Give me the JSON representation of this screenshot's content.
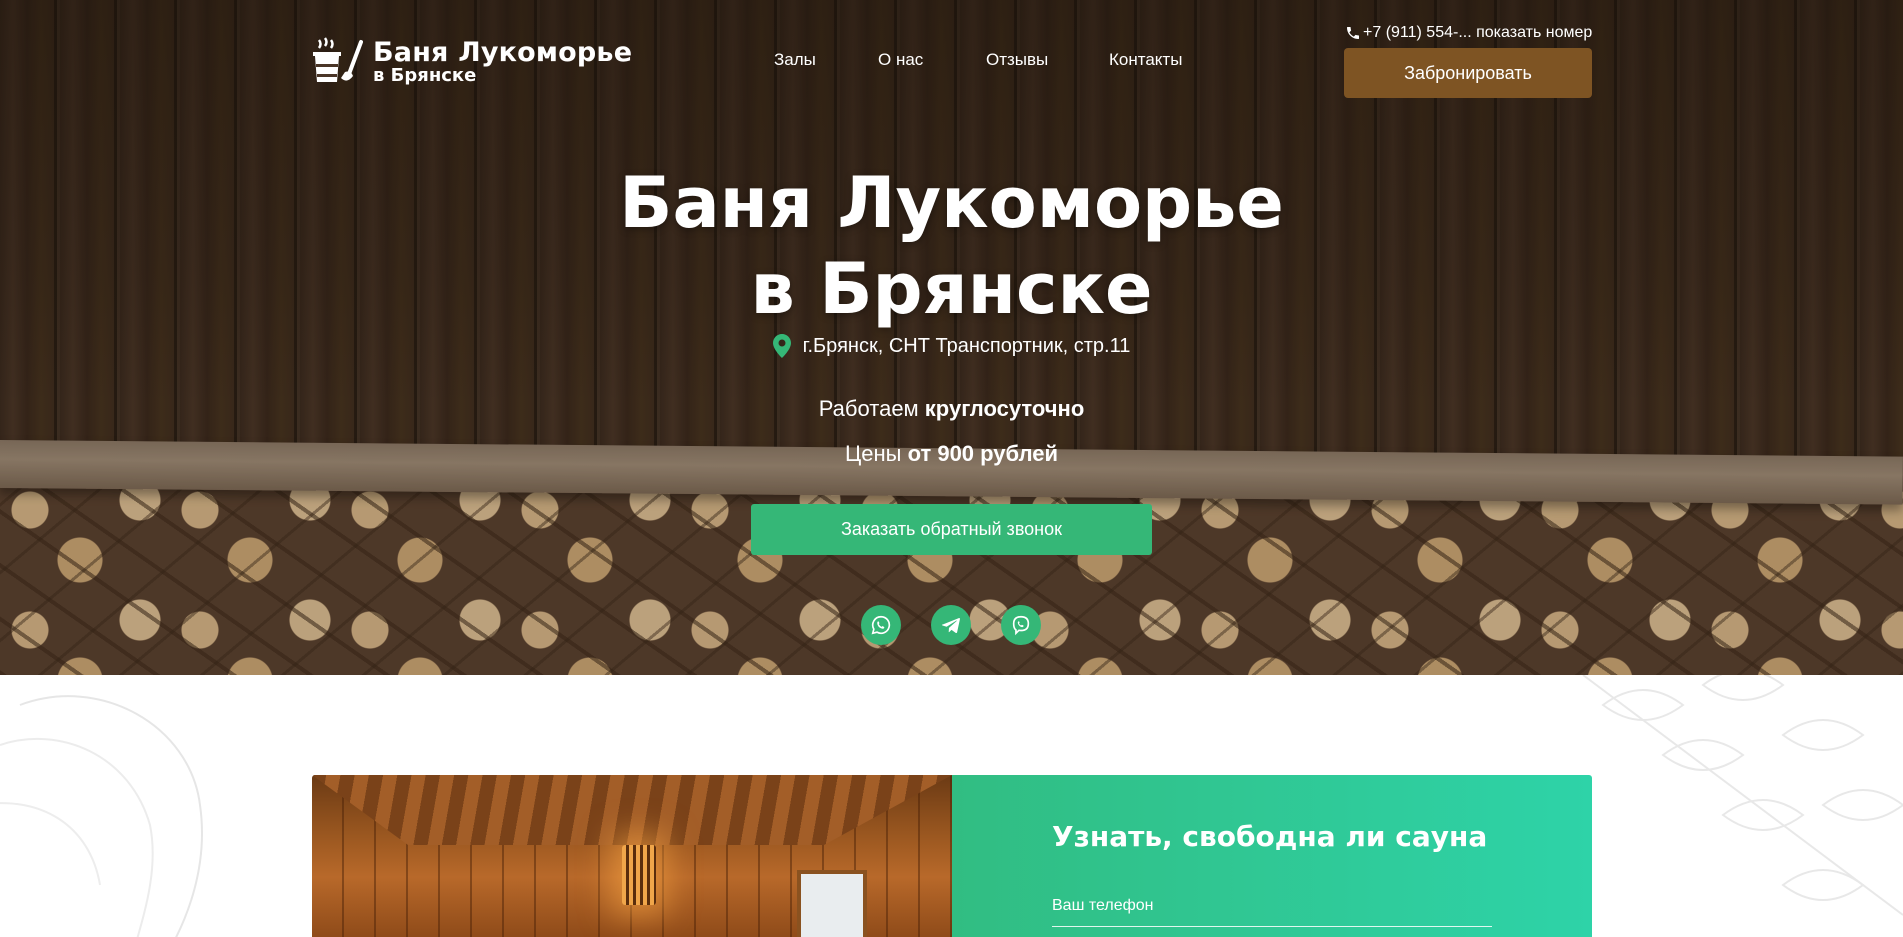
{
  "header": {
    "logo": {
      "line1": "Баня Лукоморье",
      "line2": "в Брянске"
    },
    "nav": [
      {
        "label": "Залы"
      },
      {
        "label": "О нас"
      },
      {
        "label": "Отзывы"
      },
      {
        "label": "Контакты"
      }
    ],
    "phone": "+7 (911) 554-... показать номер",
    "book_button": "Забронировать"
  },
  "hero": {
    "title_line1": "Баня Лукоморье",
    "title_line2": "в Брянске",
    "address": "г.Брянск, СНТ Транспортник, стр.11",
    "hours_prefix": "Работаем ",
    "hours_bold": "круглосуточно",
    "prices_prefix": "Цены ",
    "prices_bold": "от 900 рублей",
    "callback_button": "Заказать обратный звонок",
    "messengers": [
      "whatsapp-icon",
      "telegram-icon",
      "viber-icon"
    ]
  },
  "form": {
    "title": "Узнать, свободна ли сауна",
    "phone_label": "Ваш телефон"
  },
  "colors": {
    "accent_green": "#35b777",
    "brand_brown": "#7e5423",
    "form_gradient_start": "#31bd82",
    "form_gradient_end": "#2ed3a8"
  }
}
